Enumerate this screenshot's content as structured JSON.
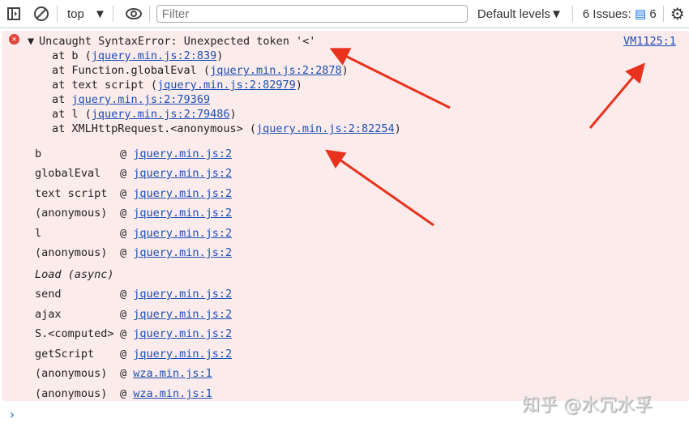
{
  "toolbar": {
    "context": "top",
    "filter_placeholder": "Filter",
    "levels": "Default levels",
    "issues_label": "6 Issues:",
    "issues_count": "6"
  },
  "error": {
    "message": "Uncaught SyntaxError: Unexpected token '<'",
    "source": "VM1125:1",
    "trace": [
      {
        "prefix": "at b (",
        "link": "jquery.min.js:2:839",
        "suffix": ")"
      },
      {
        "prefix": "at Function.globalEval (",
        "link": "jquery.min.js:2:2878",
        "suffix": ")"
      },
      {
        "prefix": "at text script (",
        "link": "jquery.min.js:2:82979",
        "suffix": ")"
      },
      {
        "prefix": "at ",
        "link": "jquery.min.js:2:79369",
        "suffix": ""
      },
      {
        "prefix": "at l (",
        "link": "jquery.min.js:2:79486",
        "suffix": ")"
      },
      {
        "prefix": "at XMLHttpRequest.<anonymous> (",
        "link": "jquery.min.js:2:82254",
        "suffix": ")"
      }
    ],
    "stack": [
      {
        "fn": "b",
        "link": "jquery.min.js:2"
      },
      {
        "fn": "globalEval",
        "link": "jquery.min.js:2"
      },
      {
        "fn": "text script",
        "link": "jquery.min.js:2"
      },
      {
        "fn": "(anonymous)",
        "link": "jquery.min.js:2"
      },
      {
        "fn": "l",
        "link": "jquery.min.js:2"
      },
      {
        "fn": "(anonymous)",
        "link": "jquery.min.js:2"
      },
      {
        "async": "Load (async)"
      },
      {
        "fn": "send",
        "link": "jquery.min.js:2"
      },
      {
        "fn": "ajax",
        "link": "jquery.min.js:2"
      },
      {
        "fn": "S.<computed>",
        "link": "jquery.min.js:2"
      },
      {
        "fn": "getScript",
        "link": "jquery.min.js:2"
      },
      {
        "fn": "(anonymous)",
        "link": "wza.min.js:1"
      },
      {
        "fn": "(anonymous)",
        "link": "wza.min.js:1"
      }
    ]
  },
  "watermark": "知乎 @水冗水孚",
  "colors": {
    "error_bg": "#fcebeb",
    "link": "#1a4fb5",
    "arrow": "#e8321e"
  }
}
